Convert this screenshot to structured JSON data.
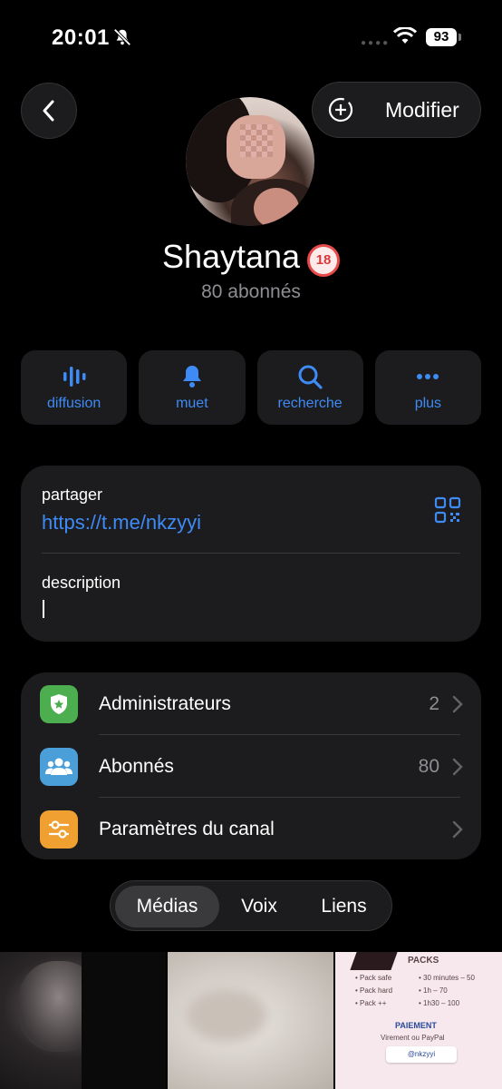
{
  "status_bar": {
    "time": "20:01",
    "battery": "93"
  },
  "header": {
    "edit_label": "Modifier"
  },
  "channel": {
    "name": "Shaytana",
    "age_badge": "18",
    "subscribers_text": "80 abonnés"
  },
  "actions": [
    {
      "label": "diffusion",
      "icon": "waveform-icon"
    },
    {
      "label": "muet",
      "icon": "bell-icon"
    },
    {
      "label": "recherche",
      "icon": "search-icon"
    },
    {
      "label": "plus",
      "icon": "more-icon"
    }
  ],
  "info": {
    "share_label": "partager",
    "share_link": "https://t.me/nkzyyi",
    "description_label": "description"
  },
  "settings": [
    {
      "label": "Administrateurs",
      "value": "2",
      "icon": "admin-badge-icon",
      "color": "#4cae4f"
    },
    {
      "label": "Abonnés",
      "value": "80",
      "icon": "people-icon",
      "color": "#4a9fd8"
    },
    {
      "label": "Paramètres du canal",
      "value": "",
      "icon": "sliders-icon",
      "color": "#f0a030"
    }
  ],
  "tabs": [
    {
      "label": "Médias",
      "active": true
    },
    {
      "label": "Voix",
      "active": false
    },
    {
      "label": "Liens",
      "active": false
    }
  ],
  "media_card": {
    "packs_title": "PACKS",
    "packs": [
      {
        "name": "• Pack safe",
        "detail": "• 30 minutes – 50"
      },
      {
        "name": "• Pack hard",
        "detail": "• 1h – 70"
      },
      {
        "name": "• Pack ++",
        "detail": "• 1h30 – 100"
      }
    ],
    "payment_title": "PAIEMENT",
    "payment_sub": "Virement ou PayPal",
    "payment_handle": "@nkzyyi"
  },
  "accent_color": "#3e8bf5"
}
